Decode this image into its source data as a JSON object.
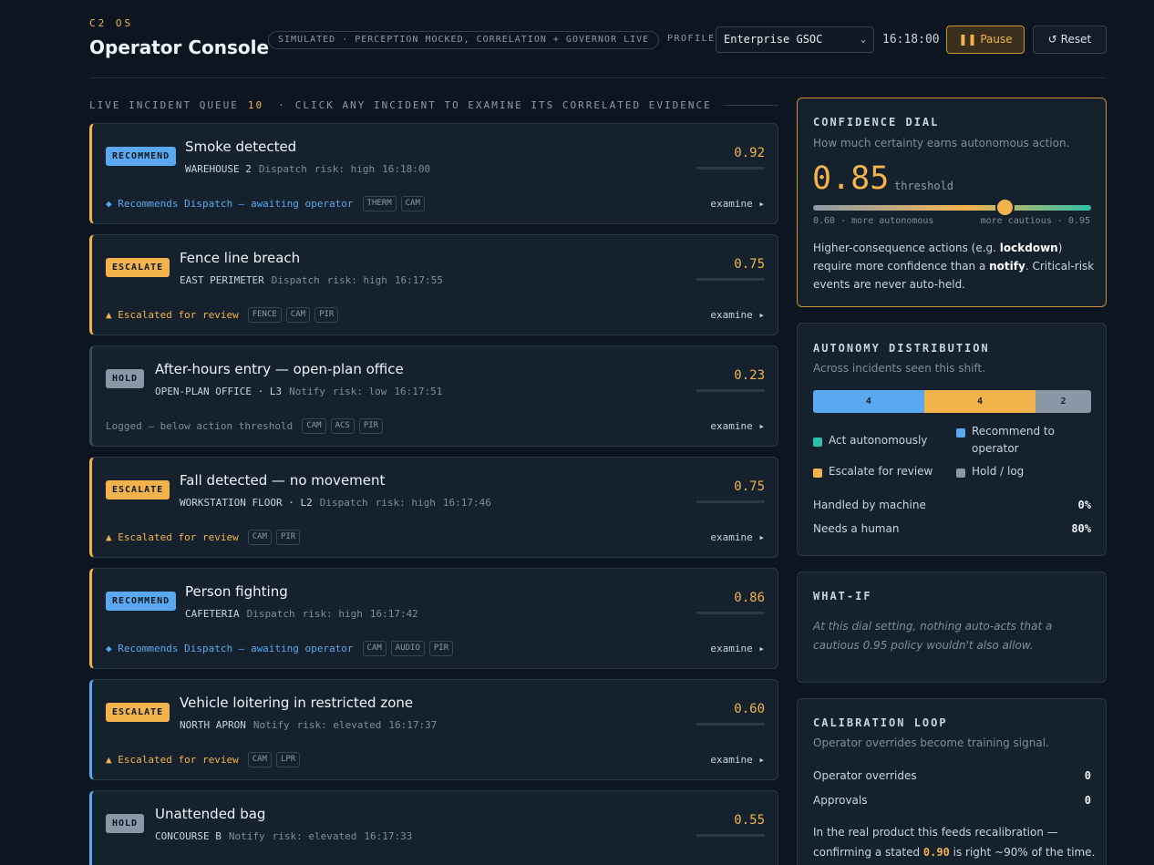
{
  "header": {
    "kicker": "C2 OS",
    "title": "Operator Console",
    "sim_pill": "SIMULATED · PERCEPTION MOCKED, CORRELATION + GOVERNOR LIVE",
    "profile_label": "PROFILE",
    "profile_value": "Enterprise GSOC",
    "clock": "16:18:00",
    "pause_label": "❚❚ Pause",
    "reset_label": "↺ Reset"
  },
  "queue": {
    "label": "LIVE INCIDENT QUEUE",
    "count": "10",
    "hint": "CLICK ANY INCIDENT TO EXAMINE ITS CORRELATED EVIDENCE",
    "examine_label": "examine ▸",
    "incidents": [
      {
        "badge": "RECOMMEND",
        "title": "Smoke detected",
        "location": "WAREHOUSE 2",
        "action": "Dispatch",
        "risk": "risk: high",
        "time": "16:18:00",
        "score": "0.92",
        "status": "◆ Recommends Dispatch — awaiting operator",
        "tags": [
          "THERM",
          "CAM"
        ]
      },
      {
        "badge": "ESCALATE",
        "title": "Fence line breach",
        "location": "EAST PERIMETER",
        "action": "Dispatch",
        "risk": "risk: high",
        "time": "16:17:55",
        "score": "0.75",
        "status": "▲ Escalated for review",
        "tags": [
          "FENCE",
          "CAM",
          "PIR"
        ]
      },
      {
        "badge": "HOLD",
        "title": "After-hours entry — open-plan office",
        "location": "OPEN-PLAN OFFICE · L3",
        "action": "Notify",
        "risk": "risk: low",
        "time": "16:17:51",
        "score": "0.23",
        "status": "Logged — below action threshold",
        "tags": [
          "CAM",
          "ACS",
          "PIR"
        ]
      },
      {
        "badge": "ESCALATE",
        "title": "Fall detected — no movement",
        "location": "WORKSTATION FLOOR · L2",
        "action": "Dispatch",
        "risk": "risk: high",
        "time": "16:17:46",
        "score": "0.75",
        "status": "▲ Escalated for review",
        "tags": [
          "CAM",
          "PIR"
        ]
      },
      {
        "badge": "RECOMMEND",
        "title": "Person fighting",
        "location": "CAFETERIA",
        "action": "Dispatch",
        "risk": "risk: high",
        "time": "16:17:42",
        "score": "0.86",
        "status": "◆ Recommends Dispatch — awaiting operator",
        "tags": [
          "CAM",
          "AUDIO",
          "PIR"
        ]
      },
      {
        "badge": "ESCALATE",
        "title": "Vehicle loitering in restricted zone",
        "location": "NORTH APRON",
        "action": "Notify",
        "risk": "risk: elevated",
        "time": "16:17:37",
        "score": "0.60",
        "status": "▲ Escalated for review",
        "tags": [
          "CAM",
          "LPR"
        ]
      },
      {
        "badge": "HOLD",
        "title": "Unattended bag",
        "location": "CONCOURSE B",
        "action": "Notify",
        "risk": "risk: elevated",
        "time": "16:17:33",
        "score": "0.55",
        "status": "",
        "tags": []
      }
    ]
  },
  "dial": {
    "title": "CONFIDENCE DIAL",
    "subtitle": "How much certainty earns autonomous action.",
    "value": "0.85",
    "threshold_label": "threshold",
    "left_label": "0.60 · more autonomous",
    "right_label": "more cautious · 0.95",
    "text_1": "Higher-consequence actions (e.g. ",
    "bold_1": "lockdown",
    "text_2": ") require more confidence than a ",
    "bold_2": "notify",
    "text_3": ". Critical-risk events are never auto-held."
  },
  "distribution": {
    "title": "AUTONOMY DISTRIBUTION",
    "subtitle": "Across incidents seen this shift.",
    "segments": [
      {
        "value": "4",
        "color": "#5aa9f0"
      },
      {
        "value": "4",
        "color": "#f2b34d"
      },
      {
        "value": "2",
        "color": "#8a97a6"
      }
    ],
    "legend": {
      "act": "Act autonomously",
      "recommend": "Recommend to operator",
      "escalate": "Escalate for review",
      "hold": "Hold / log"
    },
    "colors": {
      "act": "#2fbfa8",
      "recommend": "#5aa9f0",
      "escalate": "#f2b34d",
      "hold": "#8a97a6"
    },
    "machine_label": "Handled by machine",
    "machine_value": "0%",
    "human_label": "Needs a human",
    "human_value": "80%"
  },
  "whatif": {
    "title": "WHAT-IF",
    "text": "At this dial setting, nothing auto-acts that a cautious 0.95 policy wouldn't also allow."
  },
  "calibration": {
    "title": "CALIBRATION LOOP",
    "subtitle": "Operator overrides become training signal.",
    "overrides_label": "Operator overrides",
    "overrides_value": "0",
    "approvals_label": "Approvals",
    "approvals_value": "0",
    "text_1": "In the real product this feeds recalibration — confirming a stated ",
    "highlight": "0.90",
    "text_2": " is right ~90% of the time."
  }
}
